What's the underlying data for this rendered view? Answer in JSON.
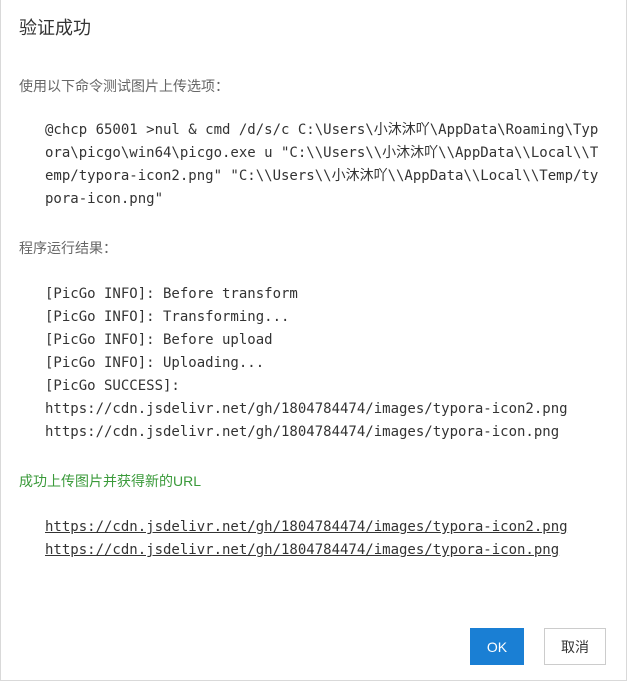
{
  "dialog": {
    "title": "验证成功"
  },
  "command_section": {
    "label": "使用以下命令测试图片上传选项：",
    "command": "@chcp 65001 >nul & cmd /d/s/c C:\\Users\\小沐沐吖\\AppData\\Roaming\\Typora\\picgo\\win64\\picgo.exe u \"C:\\\\Users\\\\小沐沐吖\\\\AppData\\\\Local\\\\Temp/typora-icon2.png\" \"C:\\\\Users\\\\小沐沐吖\\\\AppData\\\\Local\\\\Temp/typora-icon.png\""
  },
  "result_section": {
    "label": "程序运行结果：",
    "lines": [
      "[PicGo INFO]: Before transform",
      "[PicGo INFO]: Transforming...",
      "[PicGo INFO]: Before upload",
      "[PicGo INFO]: Uploading...",
      "[PicGo SUCCESS]:",
      "https://cdn.jsdelivr.net/gh/1804784474/images/typora-icon2.png",
      "https://cdn.jsdelivr.net/gh/1804784474/images/typora-icon.png"
    ]
  },
  "success_section": {
    "label": "成功上传图片并获得新的URL",
    "links": [
      "https://cdn.jsdelivr.net/gh/1804784474/images/typora-icon2.png",
      "https://cdn.jsdelivr.net/gh/1804784474/images/typora-icon.png"
    ]
  },
  "buttons": {
    "ok_label": "OK",
    "cancel_label": "取消"
  },
  "colors": {
    "primary": "#1a7fd4",
    "success_text": "#3a9a3a"
  }
}
